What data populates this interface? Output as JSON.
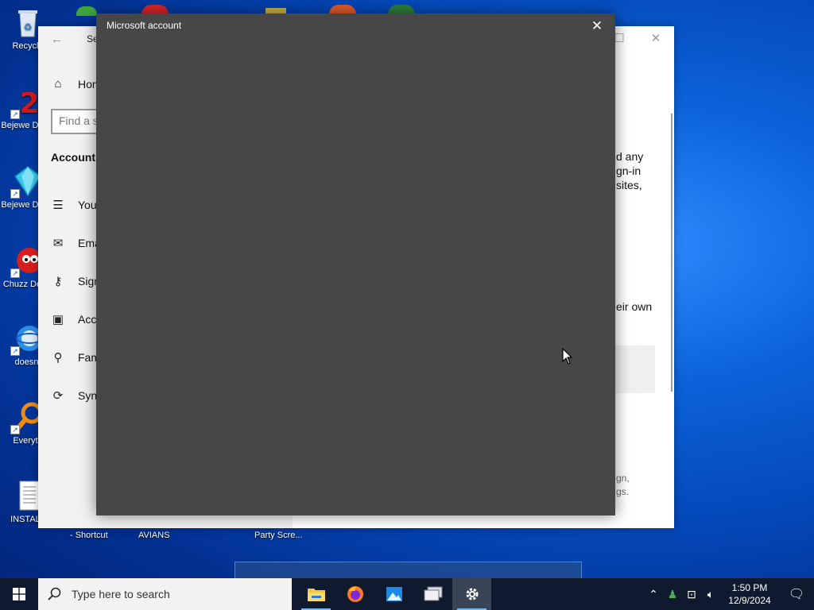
{
  "desktop": {
    "icons": [
      {
        "label": "Recycle"
      },
      {
        "label": "Bejewe Delux"
      },
      {
        "label": "Bejewe Delux"
      },
      {
        "label": "Chuzz Delux"
      },
      {
        "label": "doesnt"
      },
      {
        "label": "Everyth"
      },
      {
        "label": "INSTALL"
      }
    ],
    "bottom_labels": [
      "- Shortcut",
      "AVIANS",
      "Party Scre..."
    ]
  },
  "settings_window": {
    "title": "Se",
    "home": "Hom",
    "find_placeholder": "Find a s",
    "section": "Accounts",
    "nav_items": [
      "Your",
      "Ema",
      "Sign",
      "Acce",
      "Fam",
      "Sync"
    ],
    "body_text_1": [
      "d any",
      "gn-in",
      "sites,"
    ],
    "body_text_2": "eir own",
    "small_text": [
      "gn,",
      "gs."
    ]
  },
  "dialog": {
    "title": "Microsoft account"
  },
  "taskbar": {
    "search_placeholder": "Type here to search",
    "time": "1:50 PM",
    "date": "12/9/2024"
  }
}
